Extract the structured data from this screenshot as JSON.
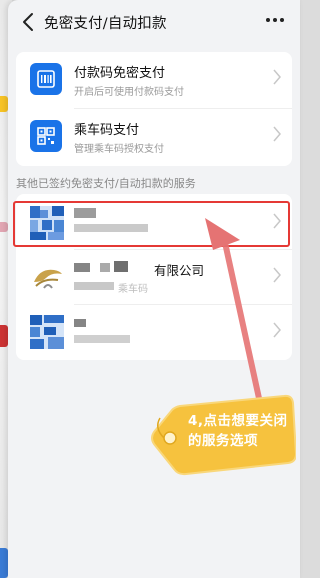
{
  "header": {
    "title": "免密支付/自动扣款",
    "back_icon": "chevron-left-icon",
    "more_icon": "more-horizontal-icon"
  },
  "top_services": [
    {
      "label": "付款码免密支付",
      "sub": "开启后可使用付款码支付",
      "icon": "barcode-scan-icon"
    },
    {
      "label": "乘车码支付",
      "sub": "管理乘车码授权支付",
      "icon": "qr-code-icon"
    }
  ],
  "section": {
    "title": "其他已签约免密支付/自动扣款的服务"
  },
  "services": [
    {
      "label": "",
      "sub": "",
      "icon": "pixelated-logo-icon"
    },
    {
      "label": "有限公司",
      "sub": "乘车码",
      "icon": "bird-logo-icon"
    },
    {
      "label": "",
      "sub": "",
      "icon": "pixelated-logo-icon"
    }
  ],
  "annotation": {
    "text": "4,点击想要关闭的服务选项",
    "color": "#f4b400"
  },
  "colors": {
    "accent": "#1a73e8",
    "highlight": "#e53935",
    "arrow": "#e57373"
  }
}
